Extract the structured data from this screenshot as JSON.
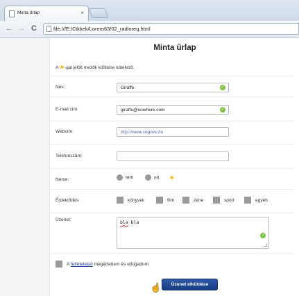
{
  "browser": {
    "tab_title": "Minta űrlap",
    "tab_close": "×",
    "back": "←",
    "forward": "→",
    "reload": "C",
    "url": "file:///E:/Cikkek/Lorem63/02_radioreq.html"
  },
  "page": {
    "title": "Minta űrlap",
    "note_prefix": "A",
    "note_suffix": "-gal jelölt mezők kitöltése kötelező."
  },
  "fields": {
    "name": {
      "label": "Név:",
      "value": "Giraffe"
    },
    "email": {
      "label": "E-mail cím:",
      "value": "giraffe@nowhere.com"
    },
    "website": {
      "label": "Webcím:",
      "placeholder": "http://www.cegnev.hu"
    },
    "phone": {
      "label": "Telefonszám:",
      "value": ""
    },
    "gender": {
      "label": "Neme:",
      "options": [
        "férfi",
        "nő"
      ]
    },
    "interests": {
      "label": "Érdeklődés:",
      "options": [
        "könyvek",
        "film",
        "zene",
        "sport",
        "egyéb"
      ]
    },
    "message": {
      "label": "Üzenet:",
      "value": "bla bla",
      "word1": "bla",
      "word2": "bla"
    }
  },
  "terms": {
    "prefix": "A",
    "link": "feltételeket",
    "suffix": "megértettem és elfogadom."
  },
  "submit_label": "Üzenet elküldése",
  "colors": {
    "submit_bg": "#1f4a96",
    "valid_icon": "#7cc242",
    "star": "#f4c20d",
    "background": "#d85a24"
  },
  "icons": [
    "page-icon",
    "star-icon",
    "check-icon",
    "hand-cursor-icon"
  ]
}
